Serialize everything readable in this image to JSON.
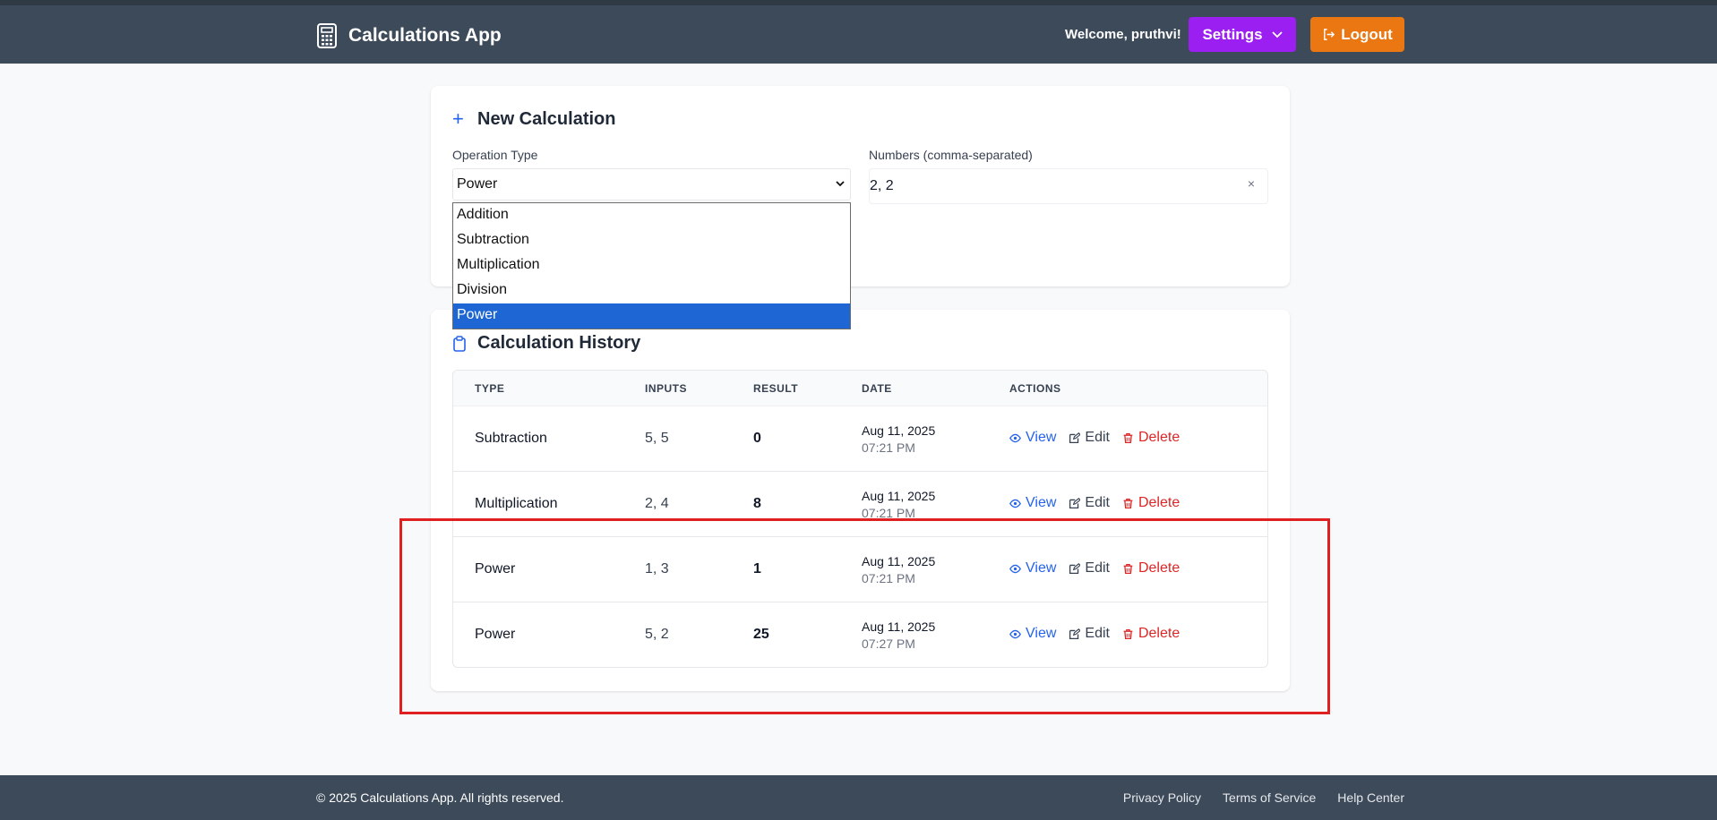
{
  "app": {
    "title": "Calculations App",
    "welcome": "Welcome, pruthvi!",
    "settings_label": "Settings",
    "logout_label": "Logout"
  },
  "new_calculation": {
    "title": "New Calculation",
    "operation_label": "Operation Type",
    "operation_value": "Power",
    "numbers_label": "Numbers (comma-separated)",
    "numbers_value": "2, 2",
    "clear_symbol": "×",
    "options": [
      "Addition",
      "Subtraction",
      "Multiplication",
      "Division",
      "Power"
    ],
    "selected_option": "Power"
  },
  "history": {
    "title": "Calculation History",
    "columns": [
      "TYPE",
      "INPUTS",
      "RESULT",
      "DATE",
      "ACTIONS"
    ],
    "rows": [
      {
        "type": "Subtraction",
        "inputs": "5, 5",
        "result": "0",
        "date": "Aug 11, 2025",
        "time": "07:21 PM"
      },
      {
        "type": "Multiplication",
        "inputs": "2, 4",
        "result": "8",
        "date": "Aug 11, 2025",
        "time": "07:21 PM"
      },
      {
        "type": "Power",
        "inputs": "1, 3",
        "result": "1",
        "date": "Aug 11, 2025",
        "time": "07:21 PM"
      },
      {
        "type": "Power",
        "inputs": "5, 2",
        "result": "25",
        "date": "Aug 11, 2025",
        "time": "07:27 PM"
      }
    ],
    "actions": {
      "view": "View",
      "edit": "Edit",
      "delete": "Delete"
    }
  },
  "footer": {
    "copyright": "© 2025 Calculations App. All rights reserved.",
    "links": [
      "Privacy Policy",
      "Terms of Service",
      "Help Center"
    ]
  },
  "colors": {
    "navbar": "#3c4a5a",
    "settings": "#9b1ff0",
    "logout": "#ea7711",
    "view": "#2563eb",
    "delete": "#dc2626",
    "highlight": "#e02020"
  }
}
